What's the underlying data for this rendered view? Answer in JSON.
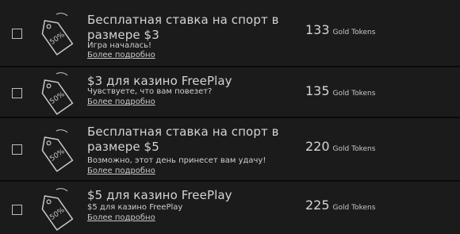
{
  "offers": [
    {
      "title": "Бесплатная ставка на спорт в размере $3",
      "description": "Игра началась!",
      "more": "Более подробно",
      "price": "133",
      "currency": "Gold Tokens",
      "discount": "50%",
      "icon": "price-tag-icon"
    },
    {
      "title": "$3 для казино FreePlay",
      "description": "Чувствуете, что вам повезет?",
      "more": "Более подробно",
      "price": "135",
      "currency": "Gold Tokens",
      "discount": "50%",
      "icon": "price-tag-icon"
    },
    {
      "title": "Бесплатная ставка на спорт в размере $5",
      "description": "Возможно, этот день принесет вам удачу!",
      "more": "Более подробно",
      "price": "220",
      "currency": "Gold Tokens",
      "discount": "50%",
      "icon": "price-tag-icon"
    },
    {
      "title": "$5 для казино FreePlay",
      "description": "$5 для казино FreePlay",
      "more": "Более подробно",
      "price": "225",
      "currency": "Gold Tokens",
      "discount": "50%",
      "icon": "price-tag-icon"
    }
  ]
}
